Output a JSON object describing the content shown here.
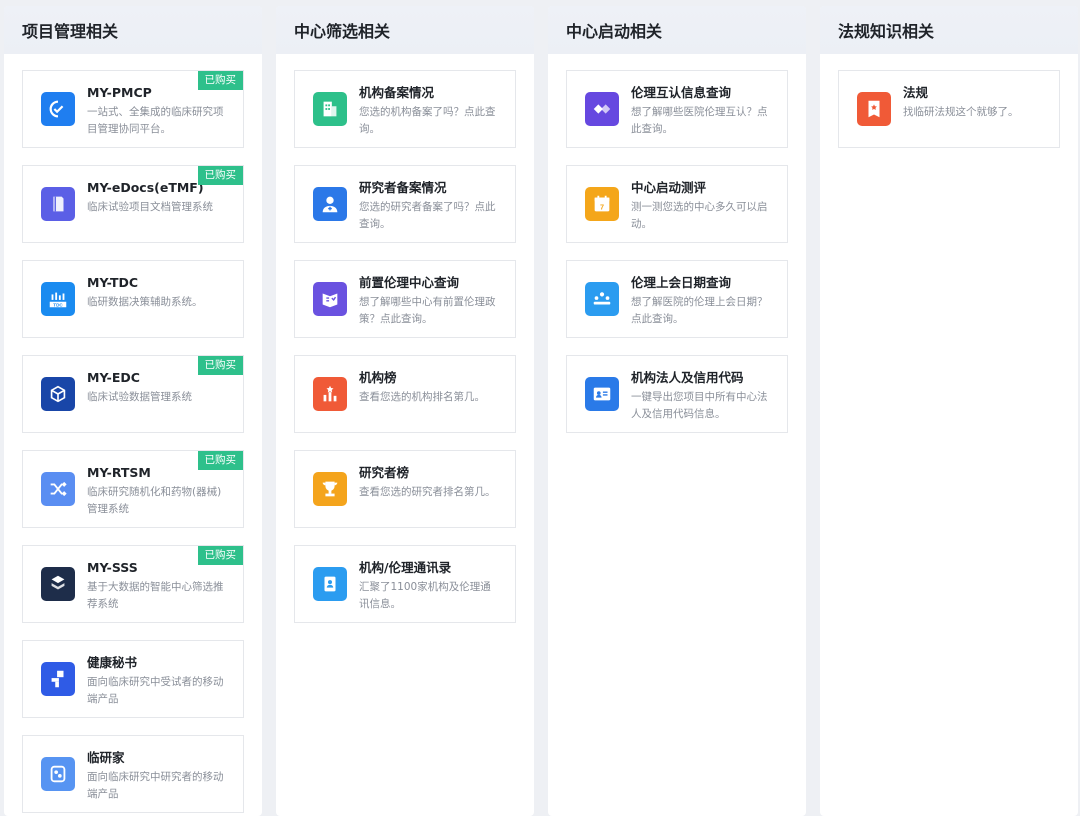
{
  "badge_label": "已购买",
  "columns": [
    {
      "title": "项目管理相关",
      "cards": [
        {
          "title": "MY-PMCP",
          "desc": "一站式、全集成的临床研究项目管理协同平台。",
          "purchased": true,
          "icon": "pmcp-icon",
          "color": "#1f7ef0"
        },
        {
          "title": "MY-eDocs(eTMF)",
          "desc": "临床试验项目文档管理系统",
          "purchased": true,
          "icon": "edocs-icon",
          "color": "#5b5fe6"
        },
        {
          "title": "MY-TDC",
          "desc": "临研数据决策辅助系统。",
          "purchased": false,
          "icon": "tdc-icon",
          "color": "#1a8bf0"
        },
        {
          "title": "MY-EDC",
          "desc": "临床试验数据管理系统",
          "purchased": true,
          "icon": "edc-icon",
          "color": "#1946a8"
        },
        {
          "title": "MY-RTSM",
          "desc": "临床研究随机化和药物(器械)管理系统",
          "purchased": true,
          "icon": "rtsm-icon",
          "color": "#5a8ef2"
        },
        {
          "title": "MY-SSS",
          "desc": "基于大数据的智能中心筛选推荐系统",
          "purchased": true,
          "icon": "sss-icon",
          "color": "#1e2d4a"
        },
        {
          "title": "健康秘书",
          "desc": "面向临床研究中受试者的移动端产品",
          "purchased": false,
          "icon": "health-secretary-icon",
          "color": "#2f5be6"
        },
        {
          "title": "临研家",
          "desc": "面向临床研究中研究者的移动端产品",
          "purchased": false,
          "icon": "researcher-app-icon",
          "color": "#5794f2"
        }
      ]
    },
    {
      "title": "中心筛选相关",
      "cards": [
        {
          "title": "机构备案情况",
          "desc": "您选的机构备案了吗？点此查询。",
          "icon": "building-icon",
          "color": "#2dc08a"
        },
        {
          "title": "研究者备案情况",
          "desc": "您选的研究者备案了吗？点此查询。",
          "icon": "doctor-icon",
          "color": "#2b78e8"
        },
        {
          "title": "前置伦理中心查询",
          "desc": "想了解哪些中心有前置伦理政策？点此查询。",
          "icon": "ethics-book-icon",
          "color": "#6a52e0"
        },
        {
          "title": "机构榜",
          "desc": "查看您选的机构排名第几。",
          "icon": "ranking-chart-icon",
          "color": "#f05a37"
        },
        {
          "title": "研究者榜",
          "desc": "查看您选的研究者排名第几。",
          "icon": "trophy-icon",
          "color": "#f4a41c"
        },
        {
          "title": "机构/伦理通讯录",
          "desc": "汇聚了1100家机构及伦理通讯信息。",
          "icon": "contacts-book-icon",
          "color": "#2b9cf0"
        }
      ]
    },
    {
      "title": "中心启动相关",
      "cards": [
        {
          "title": "伦理互认信息查询",
          "desc": "想了解哪些医院伦理互认？点此查询。",
          "icon": "mutual-recognition-icon",
          "color": "#6648e0"
        },
        {
          "title": "中心启动测评",
          "desc": "测一测您选的中心多久可以启动。",
          "icon": "calendar-icon",
          "color": "#f4a61a"
        },
        {
          "title": "伦理上会日期查询",
          "desc": "想了解医院的伦理上会日期？点此查询。",
          "icon": "meeting-icon",
          "color": "#2b9cf0"
        },
        {
          "title": "机构法人及信用代码",
          "desc": "一键导出您项目中所有中心法人及信用代码信息。",
          "icon": "id-card-icon",
          "color": "#2a7ae8"
        }
      ]
    },
    {
      "title": "法规知识相关",
      "cards": [
        {
          "title": "法规",
          "desc": "找临研法规这个就够了。",
          "icon": "regulation-icon",
          "color": "#f05a37"
        }
      ]
    }
  ]
}
